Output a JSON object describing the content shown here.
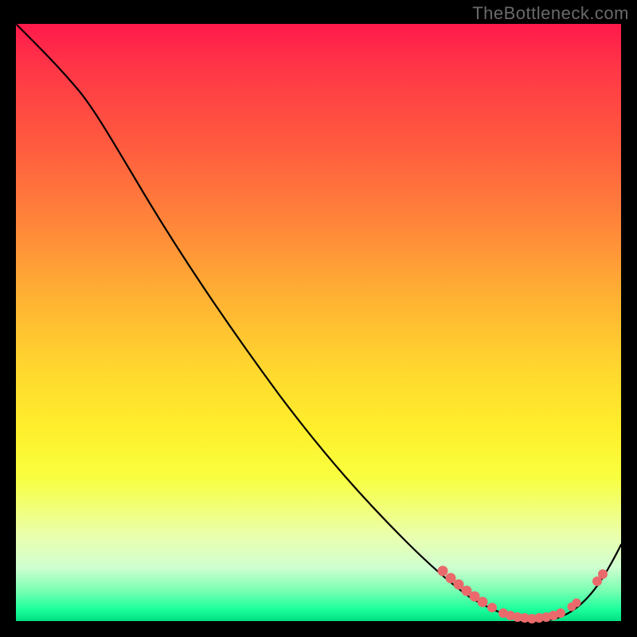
{
  "watermark": "TheBottleneck.com",
  "colors": {
    "background": "#000000",
    "dot": "#ea6a6c",
    "curve": "#000000",
    "gradient_top": "#ff1a4b",
    "gradient_bottom": "#00e083"
  },
  "chart_data": {
    "type": "line",
    "title": "",
    "xlabel": "",
    "ylabel": "",
    "xlim": [
      0,
      100
    ],
    "ylim": [
      0,
      100
    ],
    "series": [
      {
        "name": "bottleneck-curve",
        "x": [
          0,
          4,
          8,
          12,
          18,
          25,
          35,
          45,
          55,
          63,
          68,
          72,
          75,
          78,
          81,
          84,
          86,
          88,
          90,
          93,
          96,
          100
        ],
        "y": [
          100,
          98,
          96,
          93,
          88,
          80,
          67,
          54,
          41,
          30,
          22,
          15,
          10,
          6,
          3,
          1,
          0,
          0,
          0,
          2,
          6,
          12
        ]
      }
    ],
    "highlight_clusters": [
      {
        "x_range": [
          72,
          77
        ],
        "y": 3,
        "style": "dense"
      },
      {
        "x_range": [
          79,
          89
        ],
        "y": 0.5,
        "style": "dense"
      },
      {
        "x_range": [
          91,
          92
        ],
        "y": 2,
        "style": "sparse"
      },
      {
        "x_range": [
          95.5,
          97
        ],
        "y": 6,
        "style": "sparse"
      }
    ]
  }
}
